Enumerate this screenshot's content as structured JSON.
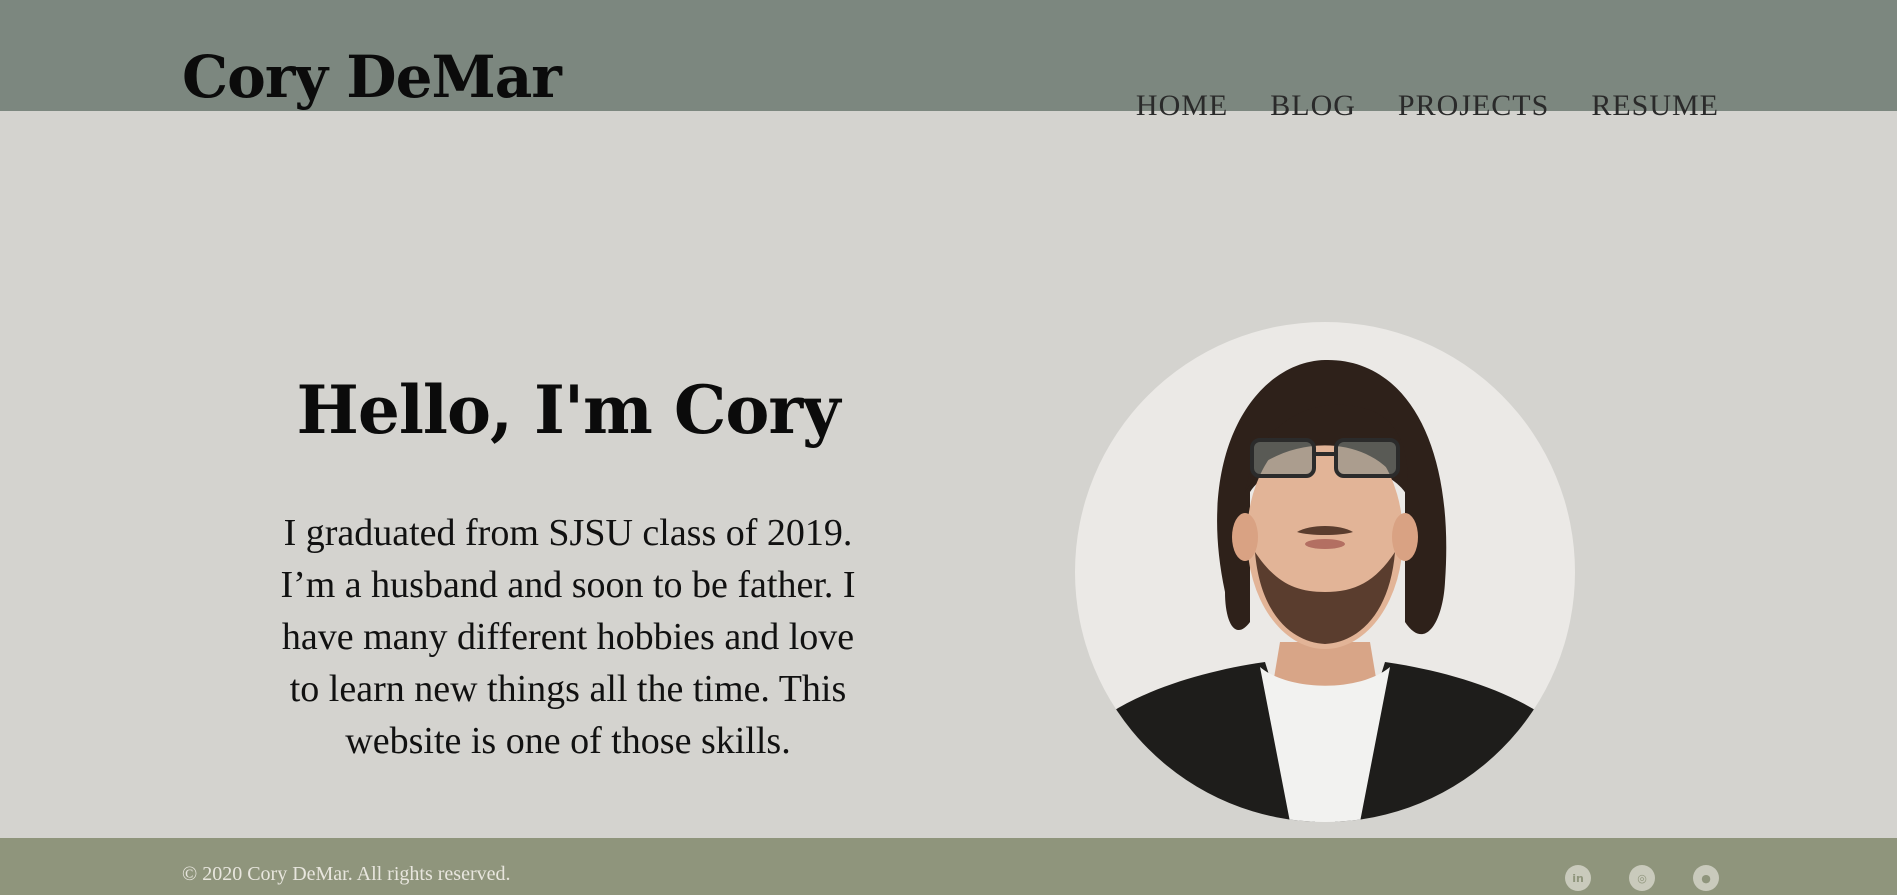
{
  "site": {
    "brand": "Cory DeMar"
  },
  "nav": {
    "items": [
      {
        "label": "HOME"
      },
      {
        "label": "BLOG"
      },
      {
        "label": "PROJECTS"
      },
      {
        "label": "RESUME"
      }
    ]
  },
  "hero": {
    "title": "Hello, I'm Cory",
    "body": "I graduated from SJSU class of 2019. I’m a husband and soon to be father. I have many different hobbies and love to learn new things all the time. This website is one of those skills."
  },
  "footer": {
    "copyright": "© 2020 Cory DeMar. All rights reserved.",
    "social": [
      {
        "icon": "linkedin-icon",
        "glyph": "in"
      },
      {
        "icon": "instagram-icon",
        "glyph": "◎"
      },
      {
        "icon": "github-icon",
        "glyph": "●"
      }
    ]
  },
  "colors": {
    "header": "#7c877f",
    "background": "#d4d3cf",
    "footer": "#8f957c"
  }
}
